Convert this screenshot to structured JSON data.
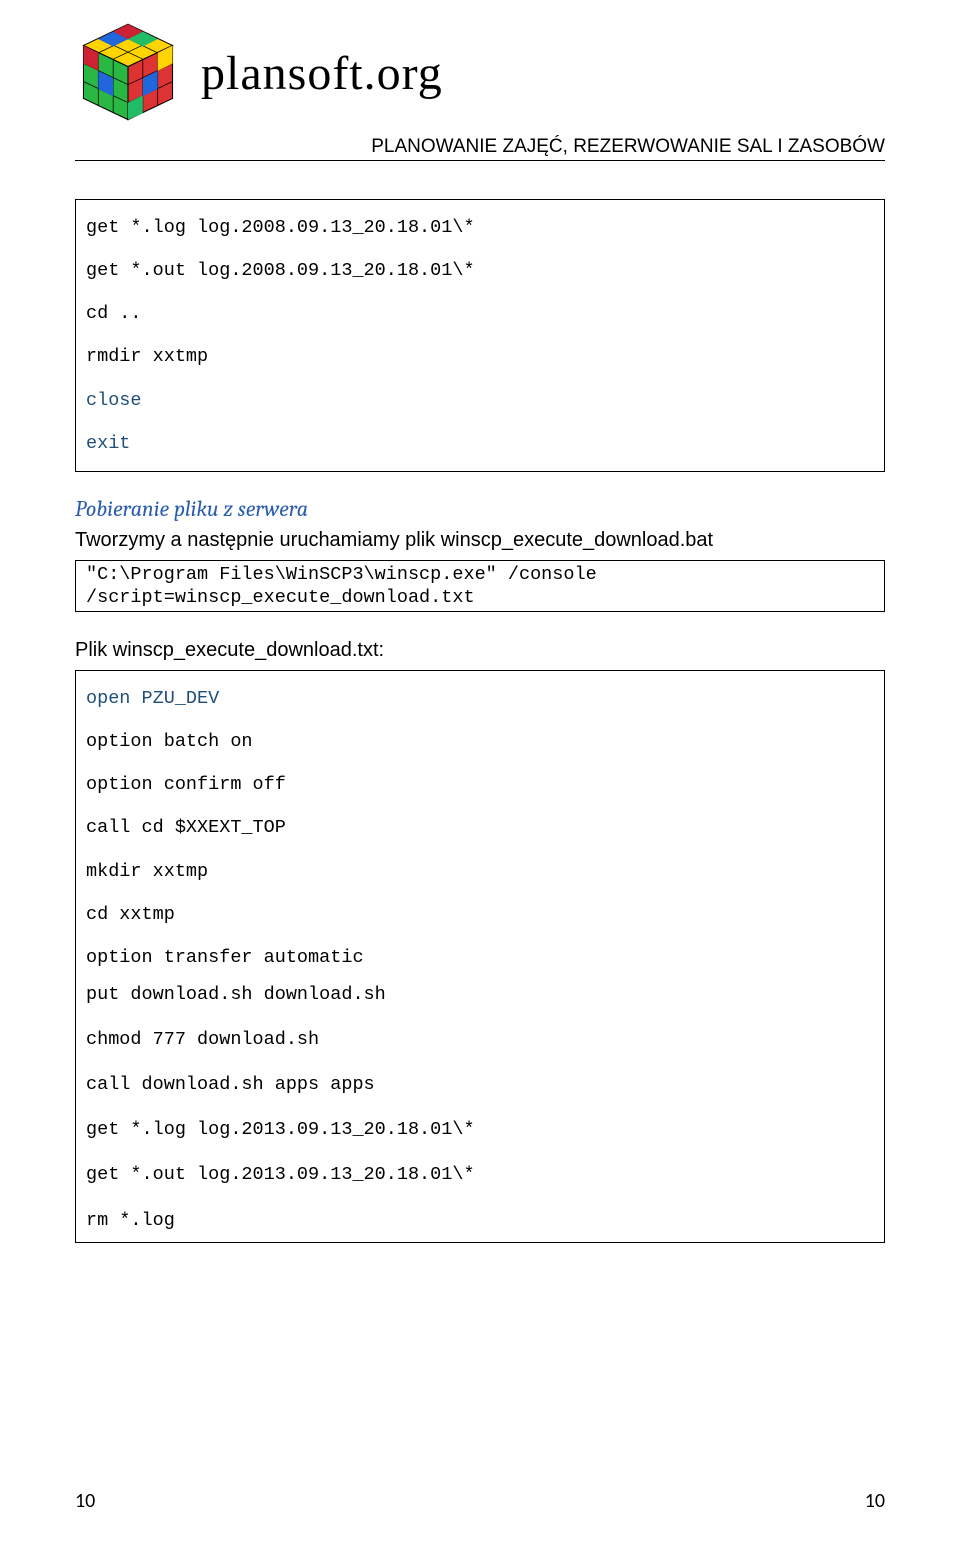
{
  "header": {
    "brand": "plansoft.org",
    "subtitle": "PLANOWANIE ZAJĘĆ, REZERWOWANIE SAL I ZASOBÓW"
  },
  "code_block_1": {
    "lines": [
      "get *.log log.2008.09.13_20.18.01\\*",
      "get *.out log.2008.09.13_20.18.01\\*",
      "cd ..",
      "rmdir xxtmp",
      "close",
      "exit"
    ]
  },
  "section": {
    "heading": "Pobieranie pliku z serwera",
    "intro": "Tworzymy a następnie uruchamiamy plik winscp_execute_download.bat"
  },
  "code_block_2": {
    "lines": [
      "\"C:\\Program Files\\WinSCP3\\winscp.exe\" /console /script=winscp_execute_download.txt"
    ]
  },
  "between_text": "Plik winscp_execute_download.txt:",
  "code_block_3": {
    "spaced": [
      "open PZU_DEV",
      "option batch on",
      "option confirm off",
      "call cd $XXEXT_TOP",
      "mkdir xxtmp",
      "cd xxtmp",
      "option transfer automatic"
    ],
    "tight": [
      "put download.sh download.sh",
      "chmod 777 download.sh",
      "call download.sh apps apps",
      "get *.log log.2013.09.13_20.18.01\\*",
      "get *.out log.2013.09.13_20.18.01\\*",
      "rm *.log"
    ]
  },
  "footer": {
    "left": "10",
    "right": "10"
  }
}
